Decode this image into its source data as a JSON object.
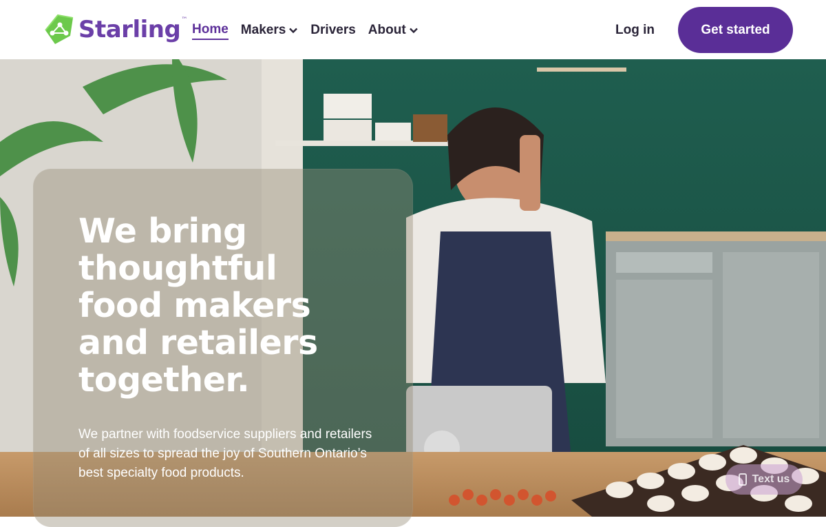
{
  "brand": {
    "name": "Starling",
    "trademark": "™",
    "logo_icon": "green-network-leaf-icon"
  },
  "nav": {
    "items": [
      {
        "label": "Home",
        "active": true,
        "dropdown": false
      },
      {
        "label": "Makers",
        "active": false,
        "dropdown": true
      },
      {
        "label": "Drivers",
        "active": false,
        "dropdown": false
      },
      {
        "label": "About",
        "active": false,
        "dropdown": true
      }
    ],
    "login_label": "Log in",
    "cta_label": "Get started"
  },
  "hero": {
    "headline": "We bring thoughtful food makers and retailers together.",
    "subtext": "We partner with foodservice suppliers and retailers of all sizes to spread the joy of Southern Ontario’s best specialty food products."
  },
  "chat_widget": {
    "label": "Text us",
    "icon": "phone-icon"
  },
  "colors": {
    "brand_purple": "#5a2e97",
    "brand_green": "#6cc94b",
    "nav_text": "#2a2438"
  }
}
